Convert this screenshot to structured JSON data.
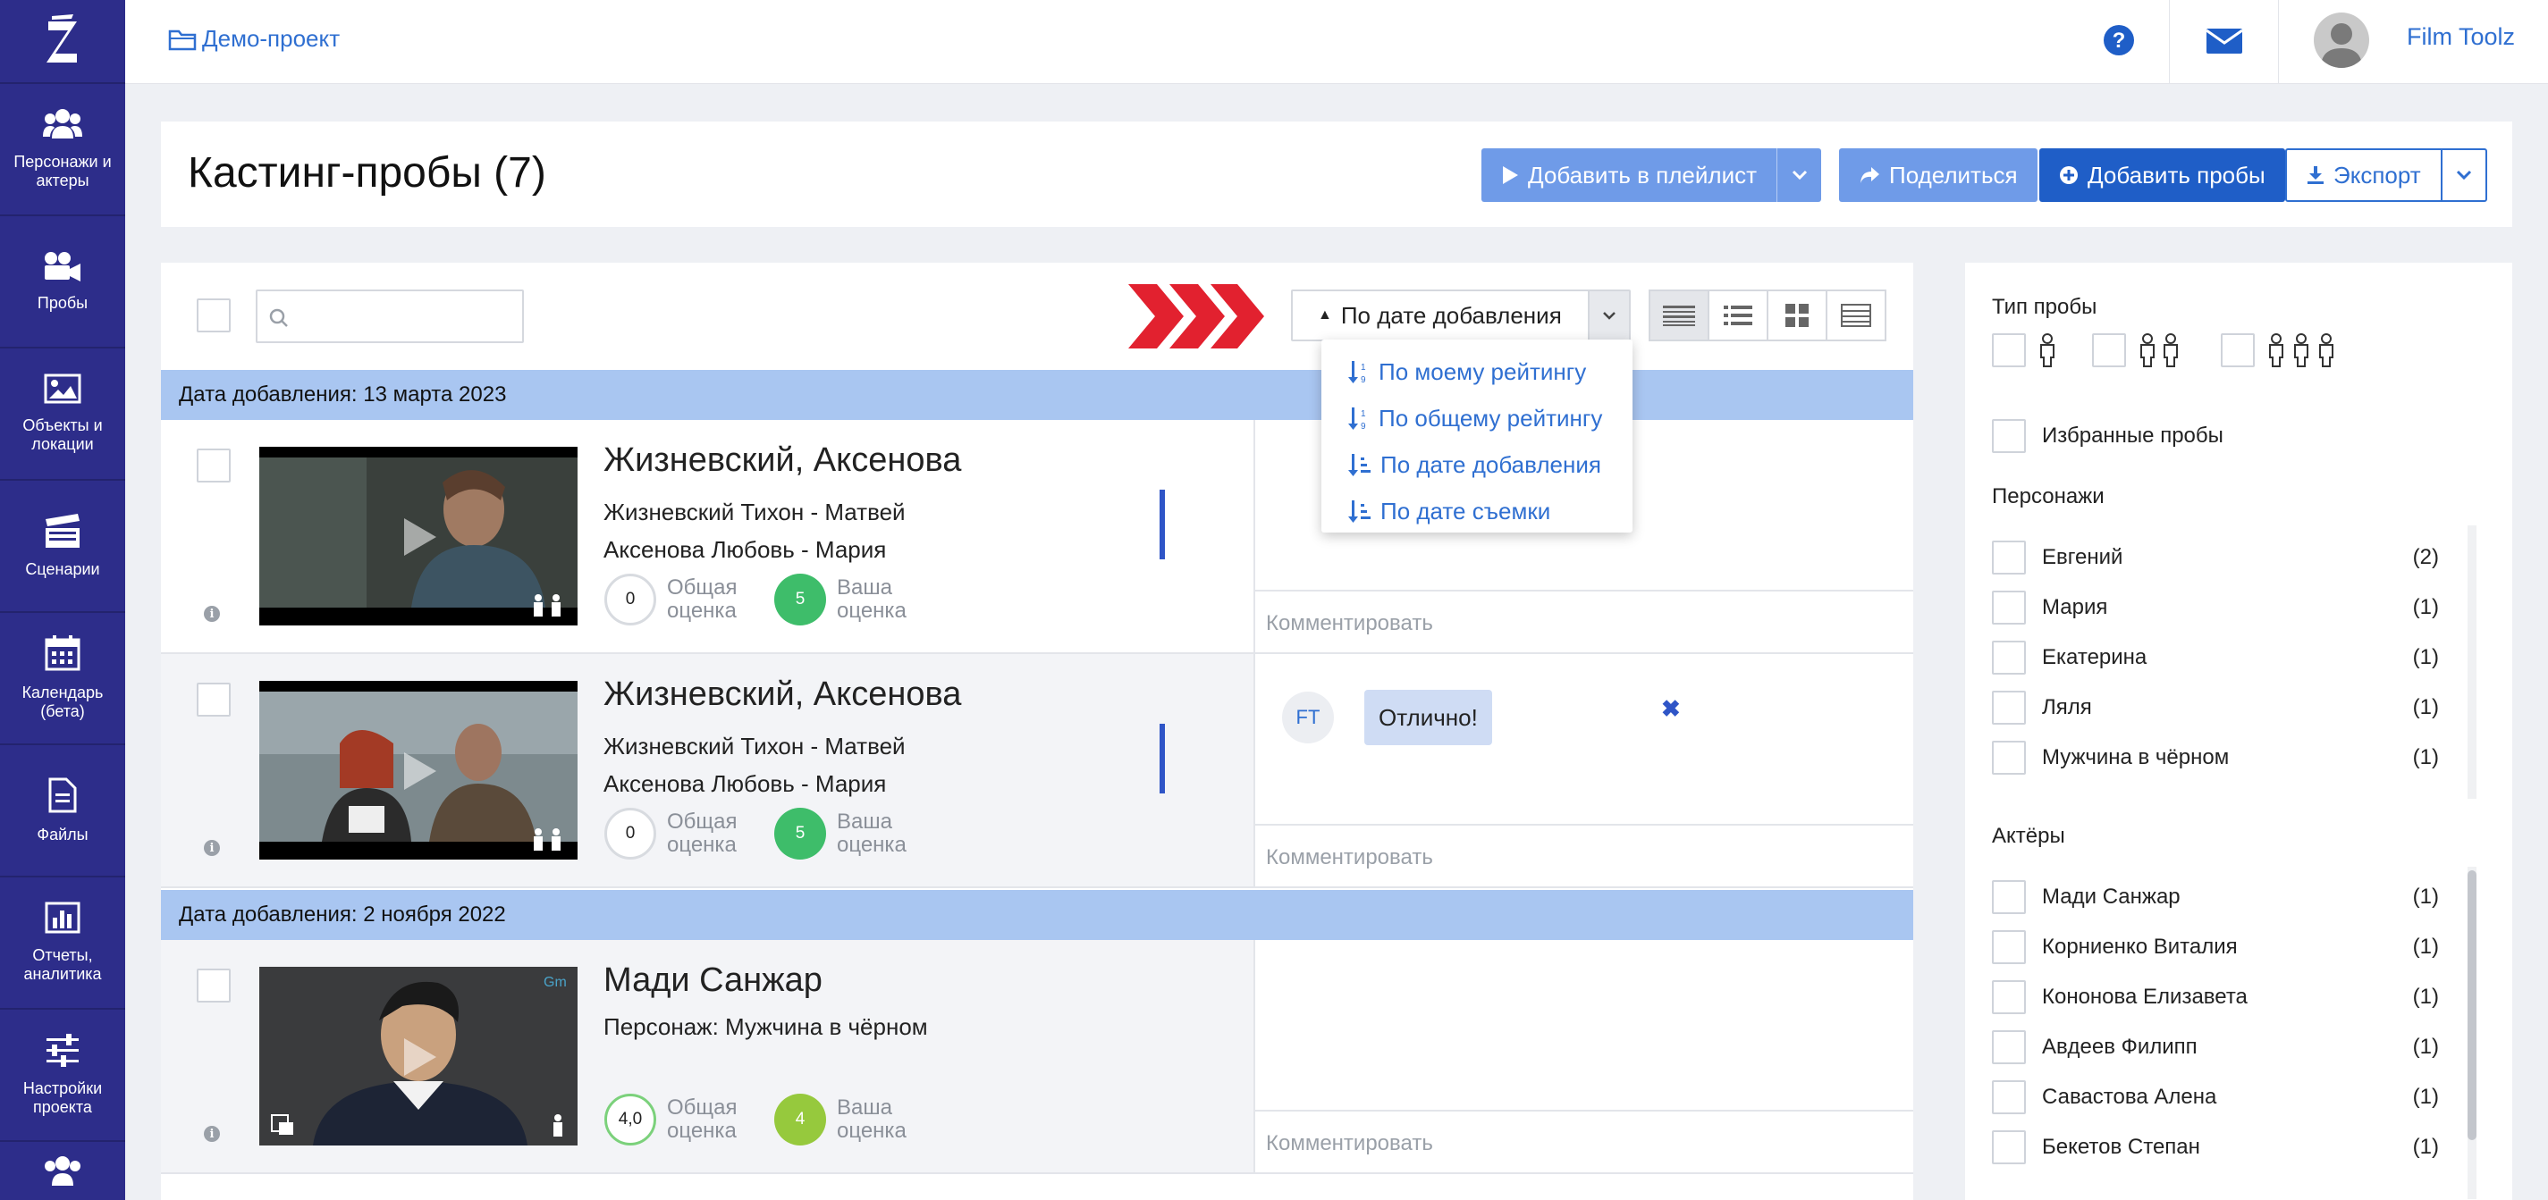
{
  "sidebar": {
    "items": [
      {
        "label": "Персонажи и актеры",
        "icon": "users-icon"
      },
      {
        "label": "Пробы",
        "icon": "video-camera-icon"
      },
      {
        "label": "Объекты и локации",
        "icon": "image-icon"
      },
      {
        "label": "Сценарии",
        "icon": "clapperboard-icon"
      },
      {
        "label": "Календарь (бета)",
        "icon": "calendar-icon"
      },
      {
        "label": "Файлы",
        "icon": "file-icon"
      },
      {
        "label": "Отчеты, аналитика",
        "icon": "chart-icon"
      },
      {
        "label": "Настройки проекта",
        "icon": "sliders-icon"
      }
    ]
  },
  "topbar": {
    "project": "Демо-проект",
    "username": "Film Toolz"
  },
  "header": {
    "title": "Кастинг-пробы (7)",
    "btn_playlist": "Добавить в плейлист",
    "btn_share": "Поделиться",
    "btn_add": "Добавить пробы",
    "btn_export": "Экспорт"
  },
  "toolbar": {
    "search_placeholder": "",
    "sort_selected": "По дате добавления"
  },
  "sort_menu": {
    "options": [
      "По моему рейтингу",
      "По общему рейтингу",
      "По дате добавления",
      "По дате съемки"
    ]
  },
  "groups": [
    {
      "date_label": "Дата добавления: 13 марта 2023"
    },
    {
      "date_label": "Дата добавления: 2 ноября 2022"
    }
  ],
  "cards": [
    {
      "title": "Жизневский, Аксенова",
      "line1": "Жизневский Тихон - Матвей",
      "line2": "Аксенова Любовь - Мария",
      "overall_score": "0",
      "my_score": "5",
      "overall_label": "Общая оценка",
      "my_label": "Ваша оценка",
      "comment_placeholder": "Комментировать"
    },
    {
      "title": "Жизневский, Аксенова",
      "line1": "Жизневский Тихон - Матвей",
      "line2": "Аксенова Любовь - Мария",
      "overall_score": "0",
      "my_score": "5",
      "overall_label": "Общая оценка",
      "my_label": "Ваша оценка",
      "comment_avatar": "FT",
      "comment_text": "Отлично!",
      "comment_placeholder": "Комментировать"
    },
    {
      "title": "Мади Санжар",
      "line1": "Персонаж: Мужчина в чёрном",
      "overall_score": "4,0",
      "my_score": "4",
      "overall_label": "Общая оценка",
      "my_label": "Ваша оценка",
      "comment_placeholder": "Комментировать"
    }
  ],
  "filters": {
    "type_label": "Тип пробы",
    "favorites_label": "Избранные пробы",
    "characters_label": "Персонажи",
    "characters": [
      {
        "name": "Евгений",
        "count": "(2)"
      },
      {
        "name": "Мария",
        "count": "(1)"
      },
      {
        "name": "Екатерина",
        "count": "(1)"
      },
      {
        "name": "Ляля",
        "count": "(1)"
      },
      {
        "name": "Мужчина в чёрном",
        "count": "(1)"
      }
    ],
    "actors_label": "Актёры",
    "actors": [
      {
        "name": "Мади Санжар",
        "count": "(1)"
      },
      {
        "name": "Корниенко Виталия",
        "count": "(1)"
      },
      {
        "name": "Кононова Елизавета",
        "count": "(1)"
      },
      {
        "name": "Авдеев Филипп",
        "count": "(1)"
      },
      {
        "name": "Савастова Алена",
        "count": "(1)"
      },
      {
        "name": "Бекетов Степан",
        "count": "(1)"
      }
    ]
  },
  "colors": {
    "sidebar": "#2d2d8a",
    "accent": "#2f6fd1",
    "date_bar": "#a9c6f1",
    "score_green": "#3ebd6a"
  }
}
